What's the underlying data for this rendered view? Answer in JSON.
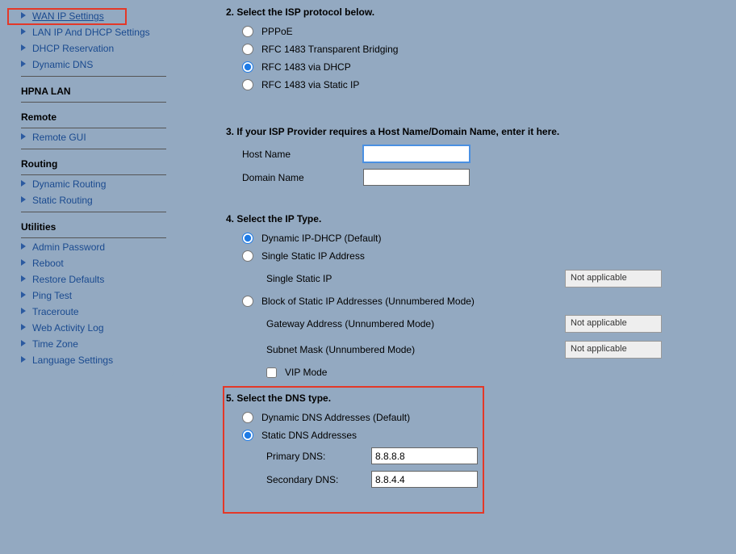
{
  "sidebar": {
    "top_items": [
      {
        "label": "WAN IP Settings",
        "current": true
      },
      {
        "label": "LAN IP And DHCP Settings"
      },
      {
        "label": "DHCP Reservation"
      },
      {
        "label": "Dynamic DNS"
      }
    ],
    "sections": [
      {
        "title": "HPNA LAN",
        "items": []
      },
      {
        "title": "Remote",
        "items": [
          {
            "label": "Remote GUI"
          }
        ]
      },
      {
        "title": "Routing",
        "items": [
          {
            "label": "Dynamic Routing"
          },
          {
            "label": "Static Routing"
          }
        ]
      },
      {
        "title": "Utilities",
        "items": [
          {
            "label": "Admin Password"
          },
          {
            "label": "Reboot"
          },
          {
            "label": "Restore Defaults"
          },
          {
            "label": "Ping Test"
          },
          {
            "label": "Traceroute"
          },
          {
            "label": "Web Activity Log"
          },
          {
            "label": "Time Zone"
          },
          {
            "label": "Language Settings"
          }
        ]
      }
    ]
  },
  "form": {
    "step2": {
      "heading": "2. Select the ISP protocol below.",
      "options": [
        {
          "label": "PPPoE",
          "checked": false
        },
        {
          "label": "RFC 1483 Transparent Bridging",
          "checked": false
        },
        {
          "label": "RFC 1483 via DHCP",
          "checked": true
        },
        {
          "label": "RFC 1483 via Static IP",
          "checked": false
        }
      ]
    },
    "step3": {
      "heading": "3. If your ISP Provider requires a Host Name/Domain Name, enter it here.",
      "host_label": "Host Name",
      "domain_label": "Domain Name",
      "host_value": "",
      "domain_value": ""
    },
    "step4": {
      "heading": "4. Select the IP Type.",
      "opt_dynamic": "Dynamic IP-DHCP (Default)",
      "opt_single": "Single Static IP Address",
      "single_ip_label": "Single Static IP",
      "opt_block": "Block of Static IP Addresses (Unnumbered Mode)",
      "gateway_label": "Gateway Address (Unnumbered Mode)",
      "subnet_label": "Subnet Mask (Unnumbered Mode)",
      "vip_label": "VIP Mode",
      "na": "Not applicable"
    },
    "step5": {
      "heading": "5. Select the DNS type.",
      "opt_dynamic": "Dynamic DNS Addresses (Default)",
      "opt_static": "Static DNS Addresses",
      "primary_label": "Primary DNS:",
      "secondary_label": "Secondary DNS:",
      "primary_value": "8.8.8.8",
      "secondary_value": "8.8.4.4"
    }
  }
}
